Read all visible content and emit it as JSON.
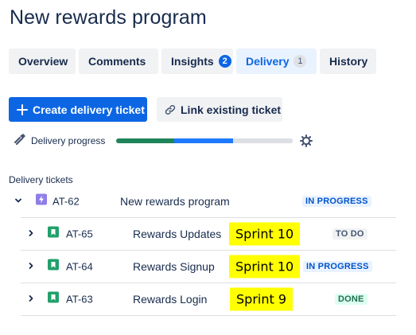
{
  "title": "New rewards program",
  "tabs": [
    {
      "label": "Overview"
    },
    {
      "label": "Comments"
    },
    {
      "label": "Insights",
      "badge": "2"
    },
    {
      "label": "Delivery",
      "badge": "1",
      "active": true
    },
    {
      "label": "History"
    }
  ],
  "actions": {
    "create_label": "Create delivery ticket",
    "link_label": "Link existing ticket"
  },
  "progress": {
    "label": "Delivery progress",
    "segments": [
      {
        "status": "done",
        "fraction": 0.33,
        "color": "#1f845a"
      },
      {
        "status": "in-progress",
        "fraction": 0.33,
        "color": "#1d7afc"
      },
      {
        "status": "todo",
        "fraction": 0.34,
        "color": "#dcdfe4"
      }
    ]
  },
  "section_label": "Delivery tickets",
  "parent_ticket": {
    "key": "AT-62",
    "summary": "New rewards program",
    "status": "IN PROGRESS",
    "icon": "epic-lightning-icon",
    "icon_color": "#8f7ee7"
  },
  "child_tickets": [
    {
      "key": "AT-65",
      "summary": "Rewards Updates",
      "sprint": "Sprint 10",
      "status": "TO DO",
      "status_type": "todo"
    },
    {
      "key": "AT-64",
      "summary": "Rewards Signup",
      "sprint": "Sprint 10",
      "status": "IN PROGRESS",
      "status_type": "inprogress"
    },
    {
      "key": "AT-63",
      "summary": "Rewards Login",
      "sprint": "Sprint 9",
      "status": "DONE",
      "status_type": "done"
    }
  ],
  "colors": {
    "brand_blue": "#0c66e4",
    "story_green": "#22a06b",
    "highlight_yellow": "#ffff00"
  }
}
